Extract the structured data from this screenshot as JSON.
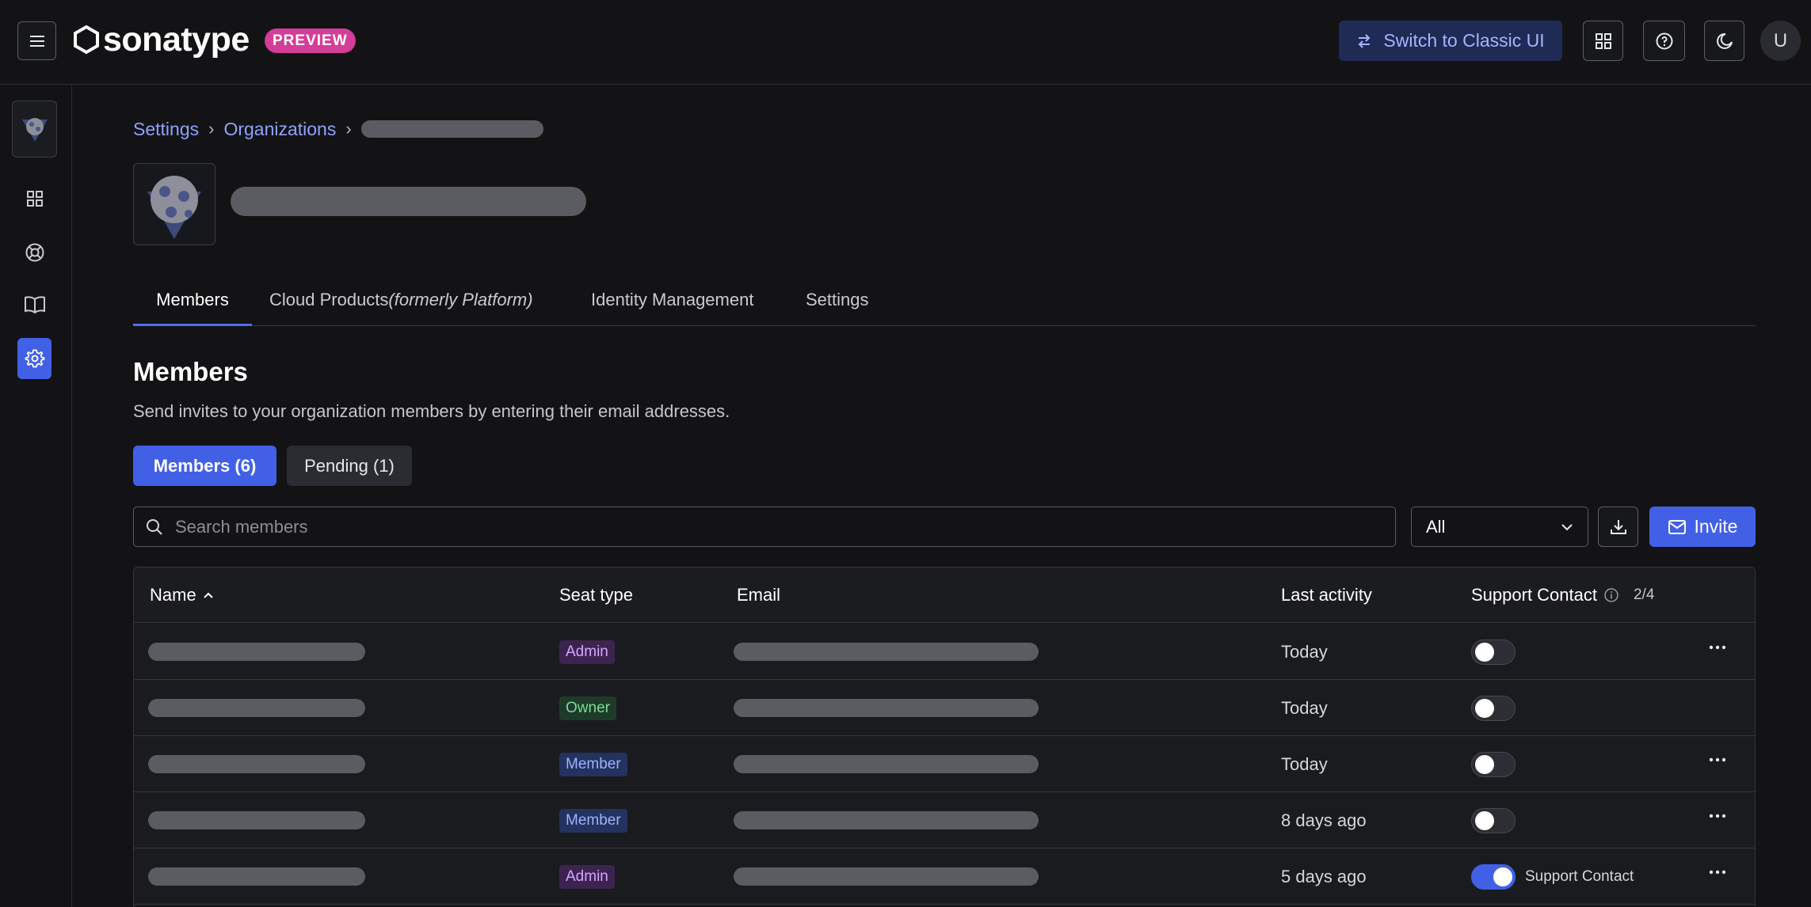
{
  "header": {
    "logo_text": "sonatype",
    "badge": "PREVIEW",
    "classic_button": "Switch to Classic UI",
    "avatar_letter": "U"
  },
  "breadcrumb": {
    "settings": "Settings",
    "organizations": "Organizations"
  },
  "tabs": [
    {
      "label": "Members",
      "active": true
    },
    {
      "label": "Cloud Products",
      "suffix": "(formerly Platform)"
    },
    {
      "label": "Identity Management"
    },
    {
      "label": "Settings"
    }
  ],
  "section": {
    "title": "Members",
    "description": "Send invites to your organization members by entering their email addresses."
  },
  "segments": {
    "members": "Members (6)",
    "pending": "Pending (1)"
  },
  "search": {
    "placeholder": "Search members"
  },
  "filter": {
    "selected": "All"
  },
  "invite_label": "Invite",
  "table": {
    "columns": {
      "name": "Name",
      "seat_type": "Seat type",
      "email": "Email",
      "last_activity": "Last activity",
      "support_contact": "Support Contact",
      "support_count": "2/4"
    },
    "rows": [
      {
        "seat": "Admin",
        "seat_kind": "admin",
        "activity": "Today",
        "support": false,
        "support_label": "",
        "menu": true
      },
      {
        "seat": "Owner",
        "seat_kind": "owner",
        "activity": "Today",
        "support": false,
        "support_label": "",
        "menu": false
      },
      {
        "seat": "Member",
        "seat_kind": "member",
        "activity": "Today",
        "support": false,
        "support_label": "",
        "menu": true
      },
      {
        "seat": "Member",
        "seat_kind": "member",
        "activity": "8 days ago",
        "support": false,
        "support_label": "",
        "menu": true
      },
      {
        "seat": "Admin",
        "seat_kind": "admin",
        "activity": "5 days ago",
        "support": true,
        "support_label": "Support Contact",
        "menu": true
      }
    ]
  },
  "colors": {
    "accent": "#4260e6",
    "link": "#8fa2ff",
    "background": "#131316"
  }
}
